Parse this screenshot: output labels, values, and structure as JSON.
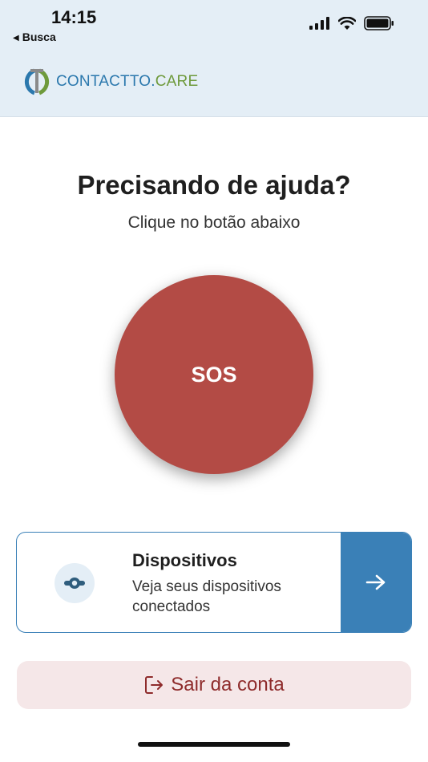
{
  "status_bar": {
    "time": "14:15",
    "back_app": "Busca",
    "icons": [
      "signal-icon",
      "wifi-icon",
      "battery-icon"
    ]
  },
  "header": {
    "logo_part1": "CONTACT",
    "logo_part2": "TO.",
    "logo_part3": "CARE",
    "colors": {
      "blue": "#2b78ad",
      "green": "#6e9a3c",
      "gray": "#8a8a8a"
    }
  },
  "main": {
    "headline": "Precisando de ajuda?",
    "subline": "Clique no botão abaixo",
    "sos_label": "SOS",
    "sos_color": "#b34b45"
  },
  "devices_card": {
    "icon": "device-icon",
    "title": "Dispositivos",
    "description": "Veja seus dispositivos conectados",
    "action_icon": "arrow-right-icon",
    "accent": "#3a80b7"
  },
  "logout": {
    "icon": "logout-icon",
    "label": "Sair da conta",
    "text_color": "#8e2b2b",
    "bg_color": "#f5e7e8"
  }
}
